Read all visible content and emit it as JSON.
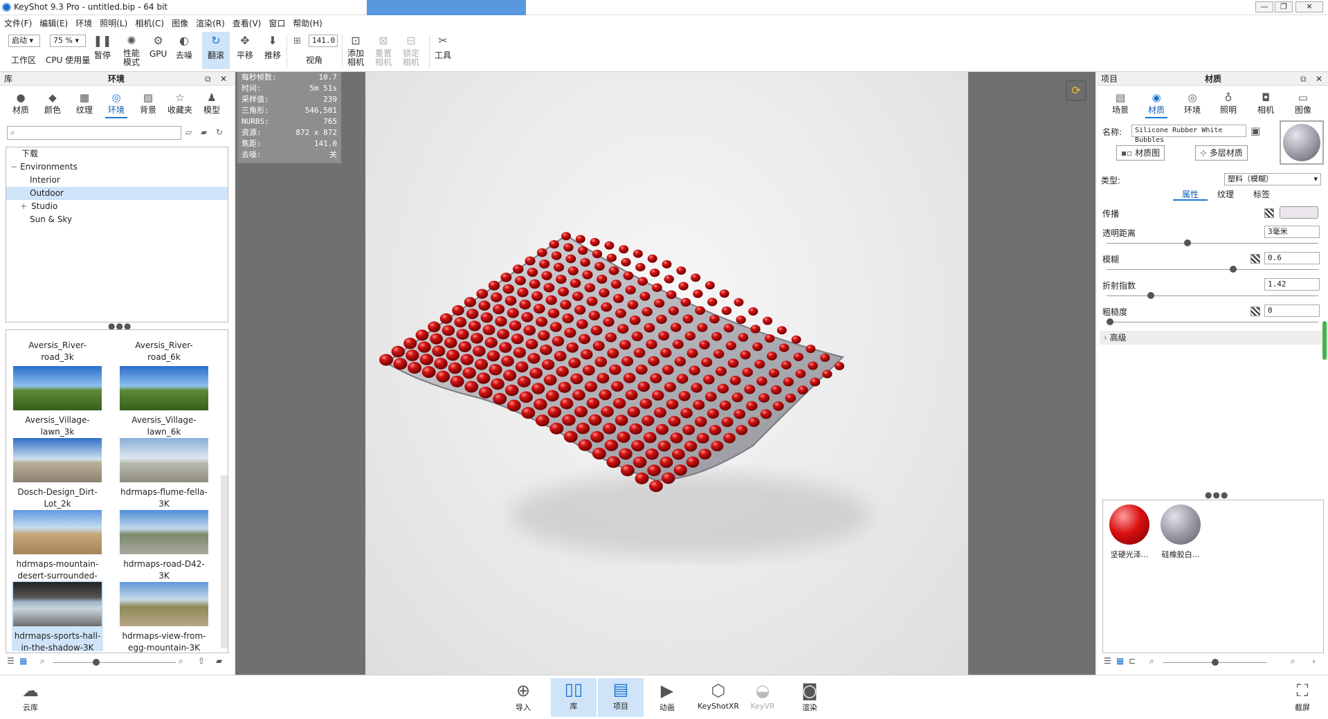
{
  "window": {
    "title": "KeyShot 9.3 Pro  - untitled.bip  - 64 bit"
  },
  "menu": [
    "文件(F)",
    "编辑(E)",
    "环境",
    "照明(L)",
    "相机(C)",
    "图像",
    "渲染(R)",
    "查看(V)",
    "窗口",
    "帮助(H)"
  ],
  "toolbar": {
    "workspace_value": "启动",
    "workspace_label": "工作区",
    "cpu_value": "75 %",
    "cpu_label": "CPU 使用量",
    "pause": "暂停",
    "perf": "性能\n模式",
    "gpu": "GPU",
    "denoise": "去噪",
    "tumble": "翻滚",
    "pan": "平移",
    "dolly": "推移",
    "fov_value": "141.0",
    "fov_label": "视角",
    "add_camera": "添加\n相机",
    "reset_camera": "重置\n相机",
    "lock_camera": "锁定\n相机",
    "tools": "工具"
  },
  "library": {
    "title": "库",
    "section": "环境",
    "tabs": [
      "材质",
      "颜色",
      "纹理",
      "环境",
      "背景",
      "收藏夹",
      "模型"
    ],
    "tree": {
      "download": "下载",
      "environments": "Environments",
      "interior": "Interior",
      "outdoor": "Outdoor",
      "studio": "Studio",
      "sunsky": "Sun & Sky"
    },
    "thumbs": [
      {
        "name": "Aversis_River-road_3k"
      },
      {
        "name": "Aversis_River-road_6k"
      },
      {
        "name": "Aversis_Village-lawn_3k"
      },
      {
        "name": "Aversis_Village-lawn_6k"
      },
      {
        "name": "Dosch-Design_Dirt-Lot_2k"
      },
      {
        "name": "hdrmaps-flume-fella-3K"
      },
      {
        "name": "hdrmaps-mountain-desert-surrounded-b..."
      },
      {
        "name": "hdrmaps-road-D42-3K"
      },
      {
        "name": "hdrmaps-sports-hall-in-the-shadow-3K"
      },
      {
        "name": "hdrmaps-view-from-egg-mountain-3K"
      }
    ]
  },
  "stats": [
    {
      "k": "每秒帧数:",
      "v": "10.7"
    },
    {
      "k": "时间:",
      "v": "5m 51s"
    },
    {
      "k": "采样值:",
      "v": "239"
    },
    {
      "k": "三角形:",
      "v": "546,501"
    },
    {
      "k": "NURBS:",
      "v": "765"
    },
    {
      "k": "资源:",
      "v": "872 x 872"
    },
    {
      "k": "焦距:",
      "v": "141.0"
    },
    {
      "k": "去噪:",
      "v": "关"
    }
  ],
  "project": {
    "title": "项目",
    "section": "材质",
    "tabs": [
      "场景",
      "材质",
      "环境",
      "照明",
      "相机",
      "图像"
    ],
    "name_label": "名称:",
    "name_value": "Silicone Rubber White Bubbles",
    "material_graph": "材质图",
    "multi_material": "多层材质",
    "type_label": "类型:",
    "type_value": "塑料（模糊）",
    "subtabs": [
      "属性",
      "纹理",
      "标签"
    ],
    "props": {
      "transmission": "传播",
      "transparency": "透明距离",
      "transparency_value": "3毫米",
      "blur": "模糊",
      "blur_value": "0.6",
      "ior": "折射指数",
      "ior_value": "1.42",
      "roughness": "粗糙度",
      "roughness_value": "0",
      "advanced": "高级"
    },
    "sliders": {
      "transparency": 0.38,
      "blur": 0.6,
      "ior": 0.2,
      "roughness": 0.0
    },
    "materials": [
      {
        "name": "坚硬光泽...",
        "color": "#d01010"
      },
      {
        "name": "硅橡胶白...",
        "color": "#9a9aa4"
      }
    ]
  },
  "bottom": {
    "cloud": "云库",
    "import": "导入",
    "library": "库",
    "project": "项目",
    "animation": "动画",
    "xr": "KeyShotXR",
    "vr": "KeyVR",
    "render": "渲染",
    "screenshot": "截屏"
  },
  "colors": {
    "accent": "#1a73d0",
    "selection": "#cfe4f8",
    "bubble": "#c00a0a"
  }
}
